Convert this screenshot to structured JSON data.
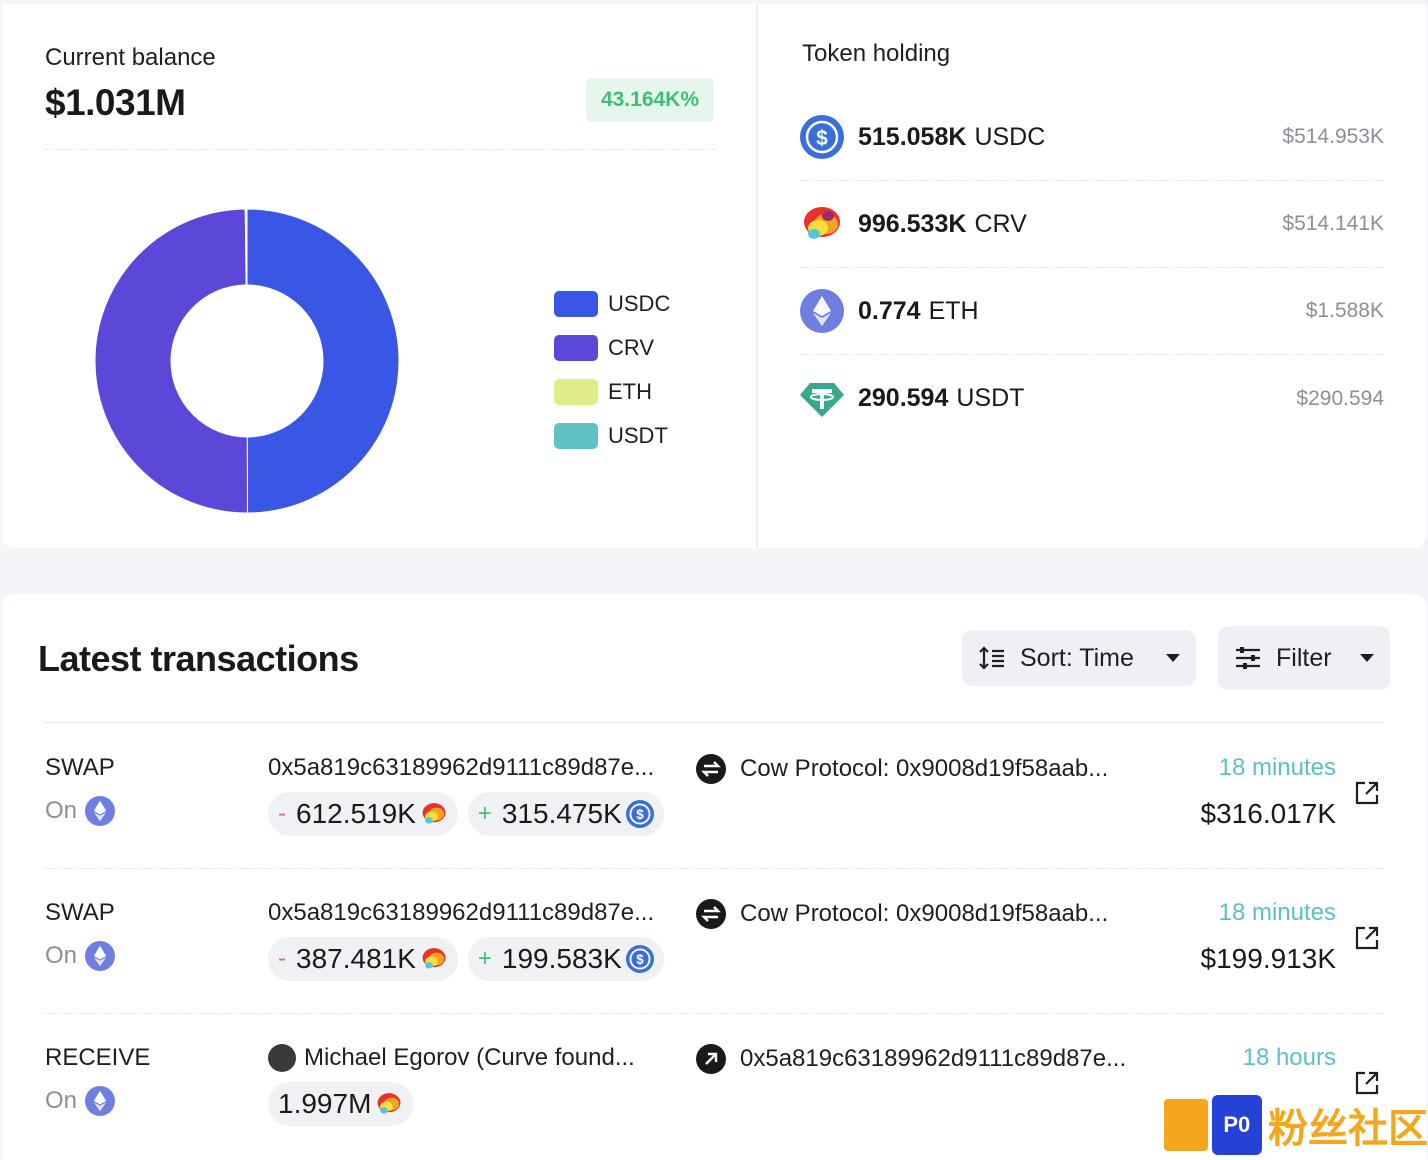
{
  "balance": {
    "label": "Current balance",
    "value": "$1.031M",
    "change": "43.164K%"
  },
  "chart_data": {
    "type": "pie",
    "donut": true,
    "categories": [
      "USDC",
      "CRV",
      "ETH",
      "USDT"
    ],
    "values": [
      514.953,
      514.141,
      1.588,
      0.290594
    ],
    "colors": [
      "#3a56e4",
      "#5b48d9",
      "#e0ec8a",
      "#5ec2c4"
    ],
    "legend": "right"
  },
  "legend": [
    {
      "label": "USDC",
      "color": "#3a56e4"
    },
    {
      "label": "CRV",
      "color": "#5b48d9"
    },
    {
      "label": "ETH",
      "color": "#e0ec8a"
    },
    {
      "label": "USDT",
      "color": "#5ec2c4"
    }
  ],
  "holdings": {
    "title": "Token holding",
    "items": [
      {
        "amount": "515.058K",
        "symbol": "USDC",
        "usd": "$514.953K",
        "icon": "usdc-icon"
      },
      {
        "amount": "996.533K",
        "symbol": "CRV",
        "usd": "$514.141K",
        "icon": "crv-icon"
      },
      {
        "amount": "0.774",
        "symbol": "ETH",
        "usd": "$1.588K",
        "icon": "eth-icon"
      },
      {
        "amount": "290.594",
        "symbol": "USDT",
        "usd": "$290.594",
        "icon": "usdt-icon"
      }
    ]
  },
  "transactions": {
    "title": "Latest transactions",
    "sort_label": "Sort: Time",
    "filter_label": "Filter",
    "rows": [
      {
        "type": "SWAP",
        "on": "On",
        "from": "0x5a819c63189962d9111c89d87e...",
        "to": "Cow Protocol: 0x9008d19f58aab...",
        "time": "18 minutes",
        "usd": "$316.017K",
        "out_amount": "612.519K",
        "in_amount": "315.475K"
      },
      {
        "type": "SWAP",
        "on": "On",
        "from": "0x5a819c63189962d9111c89d87e...",
        "to": "Cow Protocol: 0x9008d19f58aab...",
        "time": "18 minutes",
        "usd": "$199.913K",
        "out_amount": "387.481K",
        "in_amount": "199.583K"
      },
      {
        "type": "RECEIVE",
        "on": "On",
        "from": "Michael Egorov (Curve found...",
        "to": "0x5a819c63189962d9111c89d87e...",
        "time": "18 hours",
        "usd": "",
        "in_amount": "1.997M"
      }
    ]
  },
  "watermark": {
    "box_text": "P0",
    "text": "粉丝社区"
  }
}
